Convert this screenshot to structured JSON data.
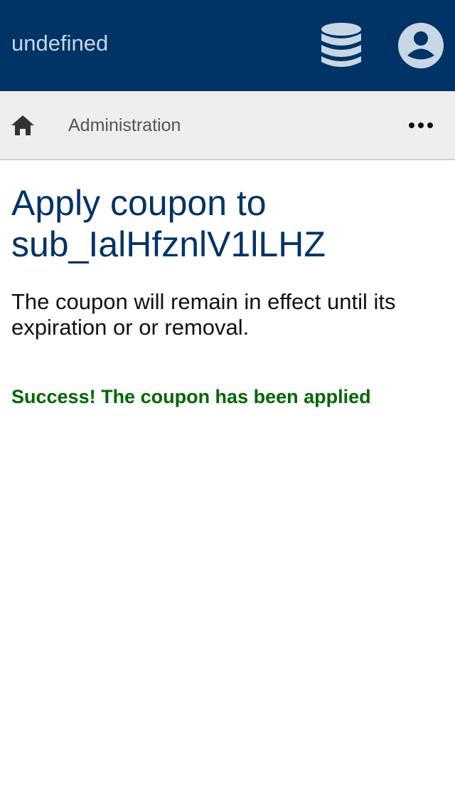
{
  "app_bar": {
    "title": "undefined",
    "icons": {
      "database": "database-icon",
      "account": "account-circle-icon"
    },
    "background": "#003366"
  },
  "toolbar": {
    "home_icon": "home-icon",
    "breadcrumb": "Administration",
    "more_icon": "more-horizontal-icon"
  },
  "main": {
    "title": "Apply coupon to sub_IalHfznlV1lLHZ",
    "description": "The coupon will remain in effect until its expiration or or removal.",
    "success_message": "Success! The coupon has been applied",
    "success_color": "#006600"
  }
}
